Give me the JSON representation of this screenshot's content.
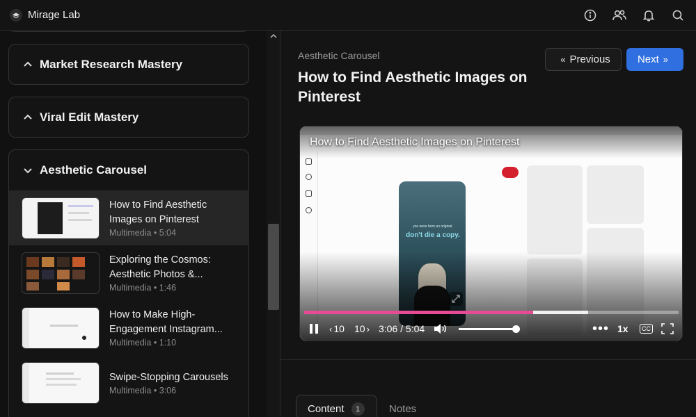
{
  "app": {
    "name": "Mirage Lab"
  },
  "topbar": {
    "icons": [
      "info-icon",
      "users-icon",
      "bell-icon",
      "search-icon"
    ]
  },
  "sidebar": {
    "modules": [
      {
        "title": "Market Research Mastery",
        "expanded": false
      },
      {
        "title": "Viral Edit Mastery",
        "expanded": false
      },
      {
        "title": "Aesthetic Carousel",
        "expanded": true
      }
    ],
    "lessons": [
      {
        "title": "How to Find Aesthetic Images on Pinterest",
        "meta": "Multimedia • 5:04",
        "active": true
      },
      {
        "title": "Exploring the Cosmos: Aesthetic Photos &...",
        "meta": "Multimedia • 1:46",
        "active": false
      },
      {
        "title": "How to Make High-Engagement Instagram...",
        "meta": "Multimedia • 1:10",
        "active": false
      },
      {
        "title": "Swipe-Stopping Carousels",
        "meta": "Multimedia • 3:06",
        "active": false
      }
    ]
  },
  "main": {
    "breadcrumb": "Aesthetic Carousel",
    "title": "How to Find Aesthetic Images on Pinterest",
    "prev_label": "Previous",
    "next_label": "Next",
    "tabs": [
      {
        "label": "Content",
        "badge": "1"
      },
      {
        "label": "Notes"
      }
    ]
  },
  "video": {
    "title": "How to Find Aesthetic Images on Pinterest",
    "pin_small_text": "you were born an original.",
    "pin_text": "don't die a copy.",
    "time_display": "3:06 / 5:04",
    "played_fraction": 0.612,
    "buffered_fraction": 0.758,
    "volume_fraction": 1.0,
    "rewind_label": "10",
    "forward_label": "10",
    "speed_label": "1x",
    "cc_label": "CC"
  },
  "colors": {
    "accent": "#2f6fe0",
    "progress": "#e84b96"
  }
}
